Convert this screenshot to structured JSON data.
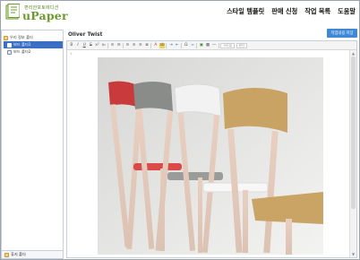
{
  "header": {
    "logo_small_text": "편리한포토에디션",
    "logo_word": "uPaper",
    "nav": [
      {
        "label": "스타일 템플릿"
      },
      {
        "label": "판매 신청"
      },
      {
        "label": "작업 목록"
      },
      {
        "label": "도움말"
      }
    ]
  },
  "sidebar": {
    "root_label": "우리 정보 폴더",
    "items": [
      {
        "label": "보드 폴더1"
      },
      {
        "label": "보드 폴더2"
      }
    ],
    "footer_label": "휴지 폴더"
  },
  "document": {
    "title": "Oliver Twist",
    "save_label": "작업내용 저장"
  },
  "toolbar": {
    "style_select": "스타일",
    "format_select": "문단"
  },
  "editor": {
    "gutter_text": "1",
    "image_icon": "image-chairs-photo"
  }
}
